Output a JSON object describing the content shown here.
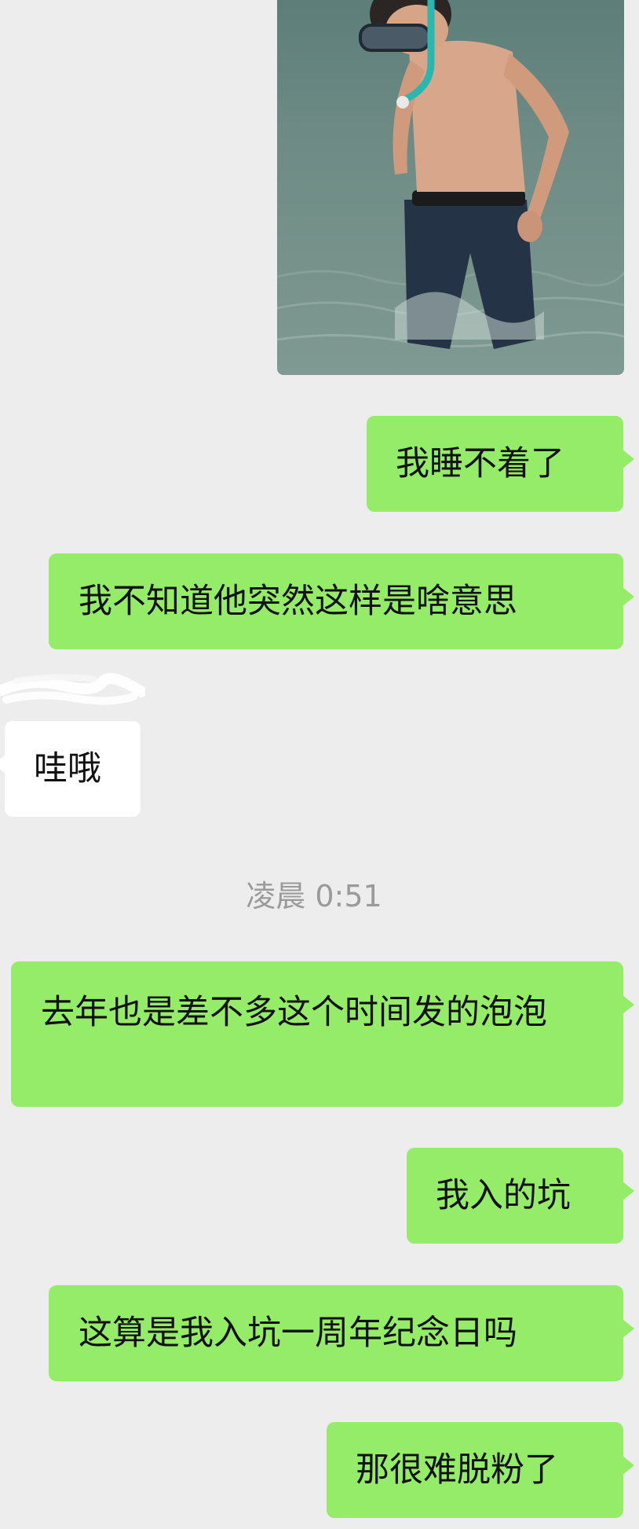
{
  "messages": [
    {
      "id": "m1",
      "type": "image",
      "side": "out",
      "image": "person-in-water-snorkel-photo"
    },
    {
      "id": "m2",
      "type": "text",
      "side": "out",
      "text": "我睡不着了"
    },
    {
      "id": "m3",
      "type": "text",
      "side": "out",
      "text": "我不知道他突然这样是啥意思"
    },
    {
      "id": "m4",
      "type": "text",
      "side": "in",
      "text": "哇哦"
    },
    {
      "id": "m5",
      "type": "text",
      "side": "out",
      "text": "去年也是差不多这个时间发的泡泡"
    },
    {
      "id": "m6",
      "type": "text",
      "side": "out",
      "text": "我入的坑"
    },
    {
      "id": "m7",
      "type": "text",
      "side": "out",
      "text": "这算是我入坑一周年纪念日吗"
    },
    {
      "id": "m8",
      "type": "text",
      "side": "out",
      "text": "那很难脱粉了"
    }
  ],
  "timestamp": "凌晨 0:51",
  "colors": {
    "background": "#ededed",
    "outgoing_bubble": "#95ec69",
    "incoming_bubble": "#ffffff",
    "timestamp_text": "#9a9a9a"
  }
}
